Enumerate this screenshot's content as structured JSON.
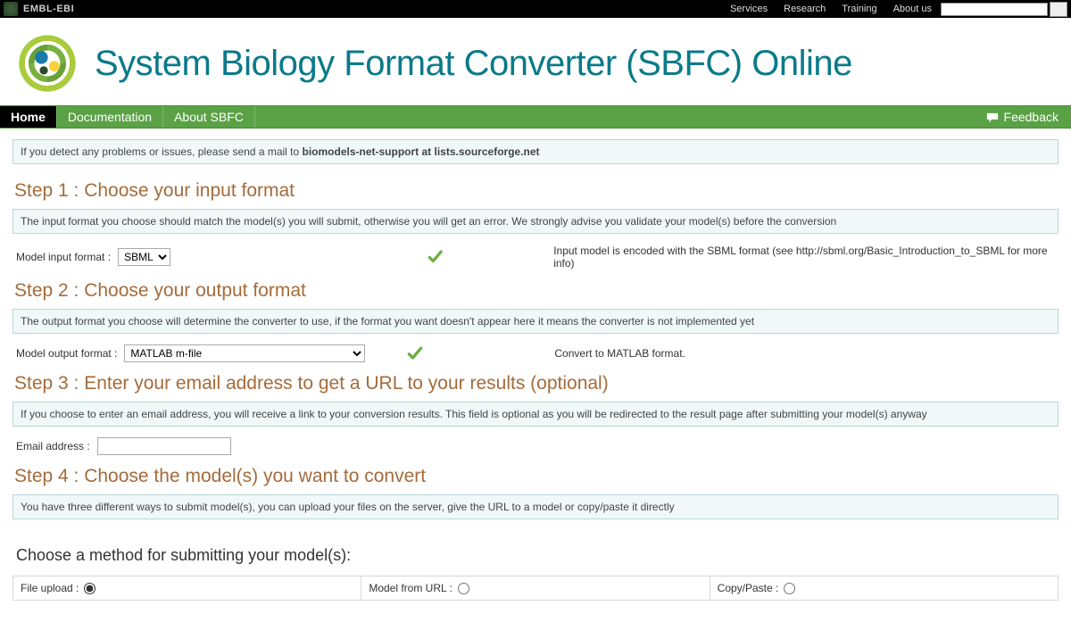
{
  "topbar": {
    "brand": "EMBL-EBI",
    "links": [
      "Services",
      "Research",
      "Training",
      "About us"
    ]
  },
  "header": {
    "title": "System Biology Format Converter (SBFC) Online"
  },
  "nav": {
    "items": [
      {
        "label": "Home",
        "active": true
      },
      {
        "label": "Documentation",
        "active": false
      },
      {
        "label": "About SBFC",
        "active": false
      }
    ],
    "feedback": "Feedback"
  },
  "notice": {
    "prefix": "If you detect any problems or issues, please send a mail to ",
    "bold": "biomodels-net-support at lists.sourceforge.net"
  },
  "step1": {
    "title": "Step 1 : Choose your input format",
    "desc": "The input format you choose should match the model(s) you will submit, otherwise you will get an error. We strongly advise you validate your model(s) before the conversion",
    "label": "Model input format :",
    "value": "SBML",
    "hint": "Input model is encoded with the SBML format (see http://sbml.org/Basic_Introduction_to_SBML for more info)"
  },
  "step2": {
    "title": "Step 2 : Choose your output format",
    "desc": "The output format you choose will determine the converter to use, if the format you want doesn't appear here it means the converter is not implemented yet",
    "label": "Model output format :",
    "value": "MATLAB m-file",
    "hint": "Convert to MATLAB format."
  },
  "step3": {
    "title": "Step 3 : Enter your email address to get a URL to your results (optional)",
    "desc": "If you choose to enter an email address, you will receive a link to your conversion results. This field is optional as you will be redirected to the result page after submitting your model(s) anyway",
    "label": "Email address :"
  },
  "step4": {
    "title": "Step 4 : Choose the model(s) you want to convert",
    "desc": "You have three different ways to submit model(s), you can upload your files on the server, give the URL to a model or copy/paste it directly"
  },
  "submit": {
    "title": "Choose a method for submitting your model(s):",
    "methods": [
      {
        "label": "File upload :",
        "checked": true
      },
      {
        "label": "Model from URL :",
        "checked": false
      },
      {
        "label": "Copy/Paste :",
        "checked": false
      }
    ]
  }
}
